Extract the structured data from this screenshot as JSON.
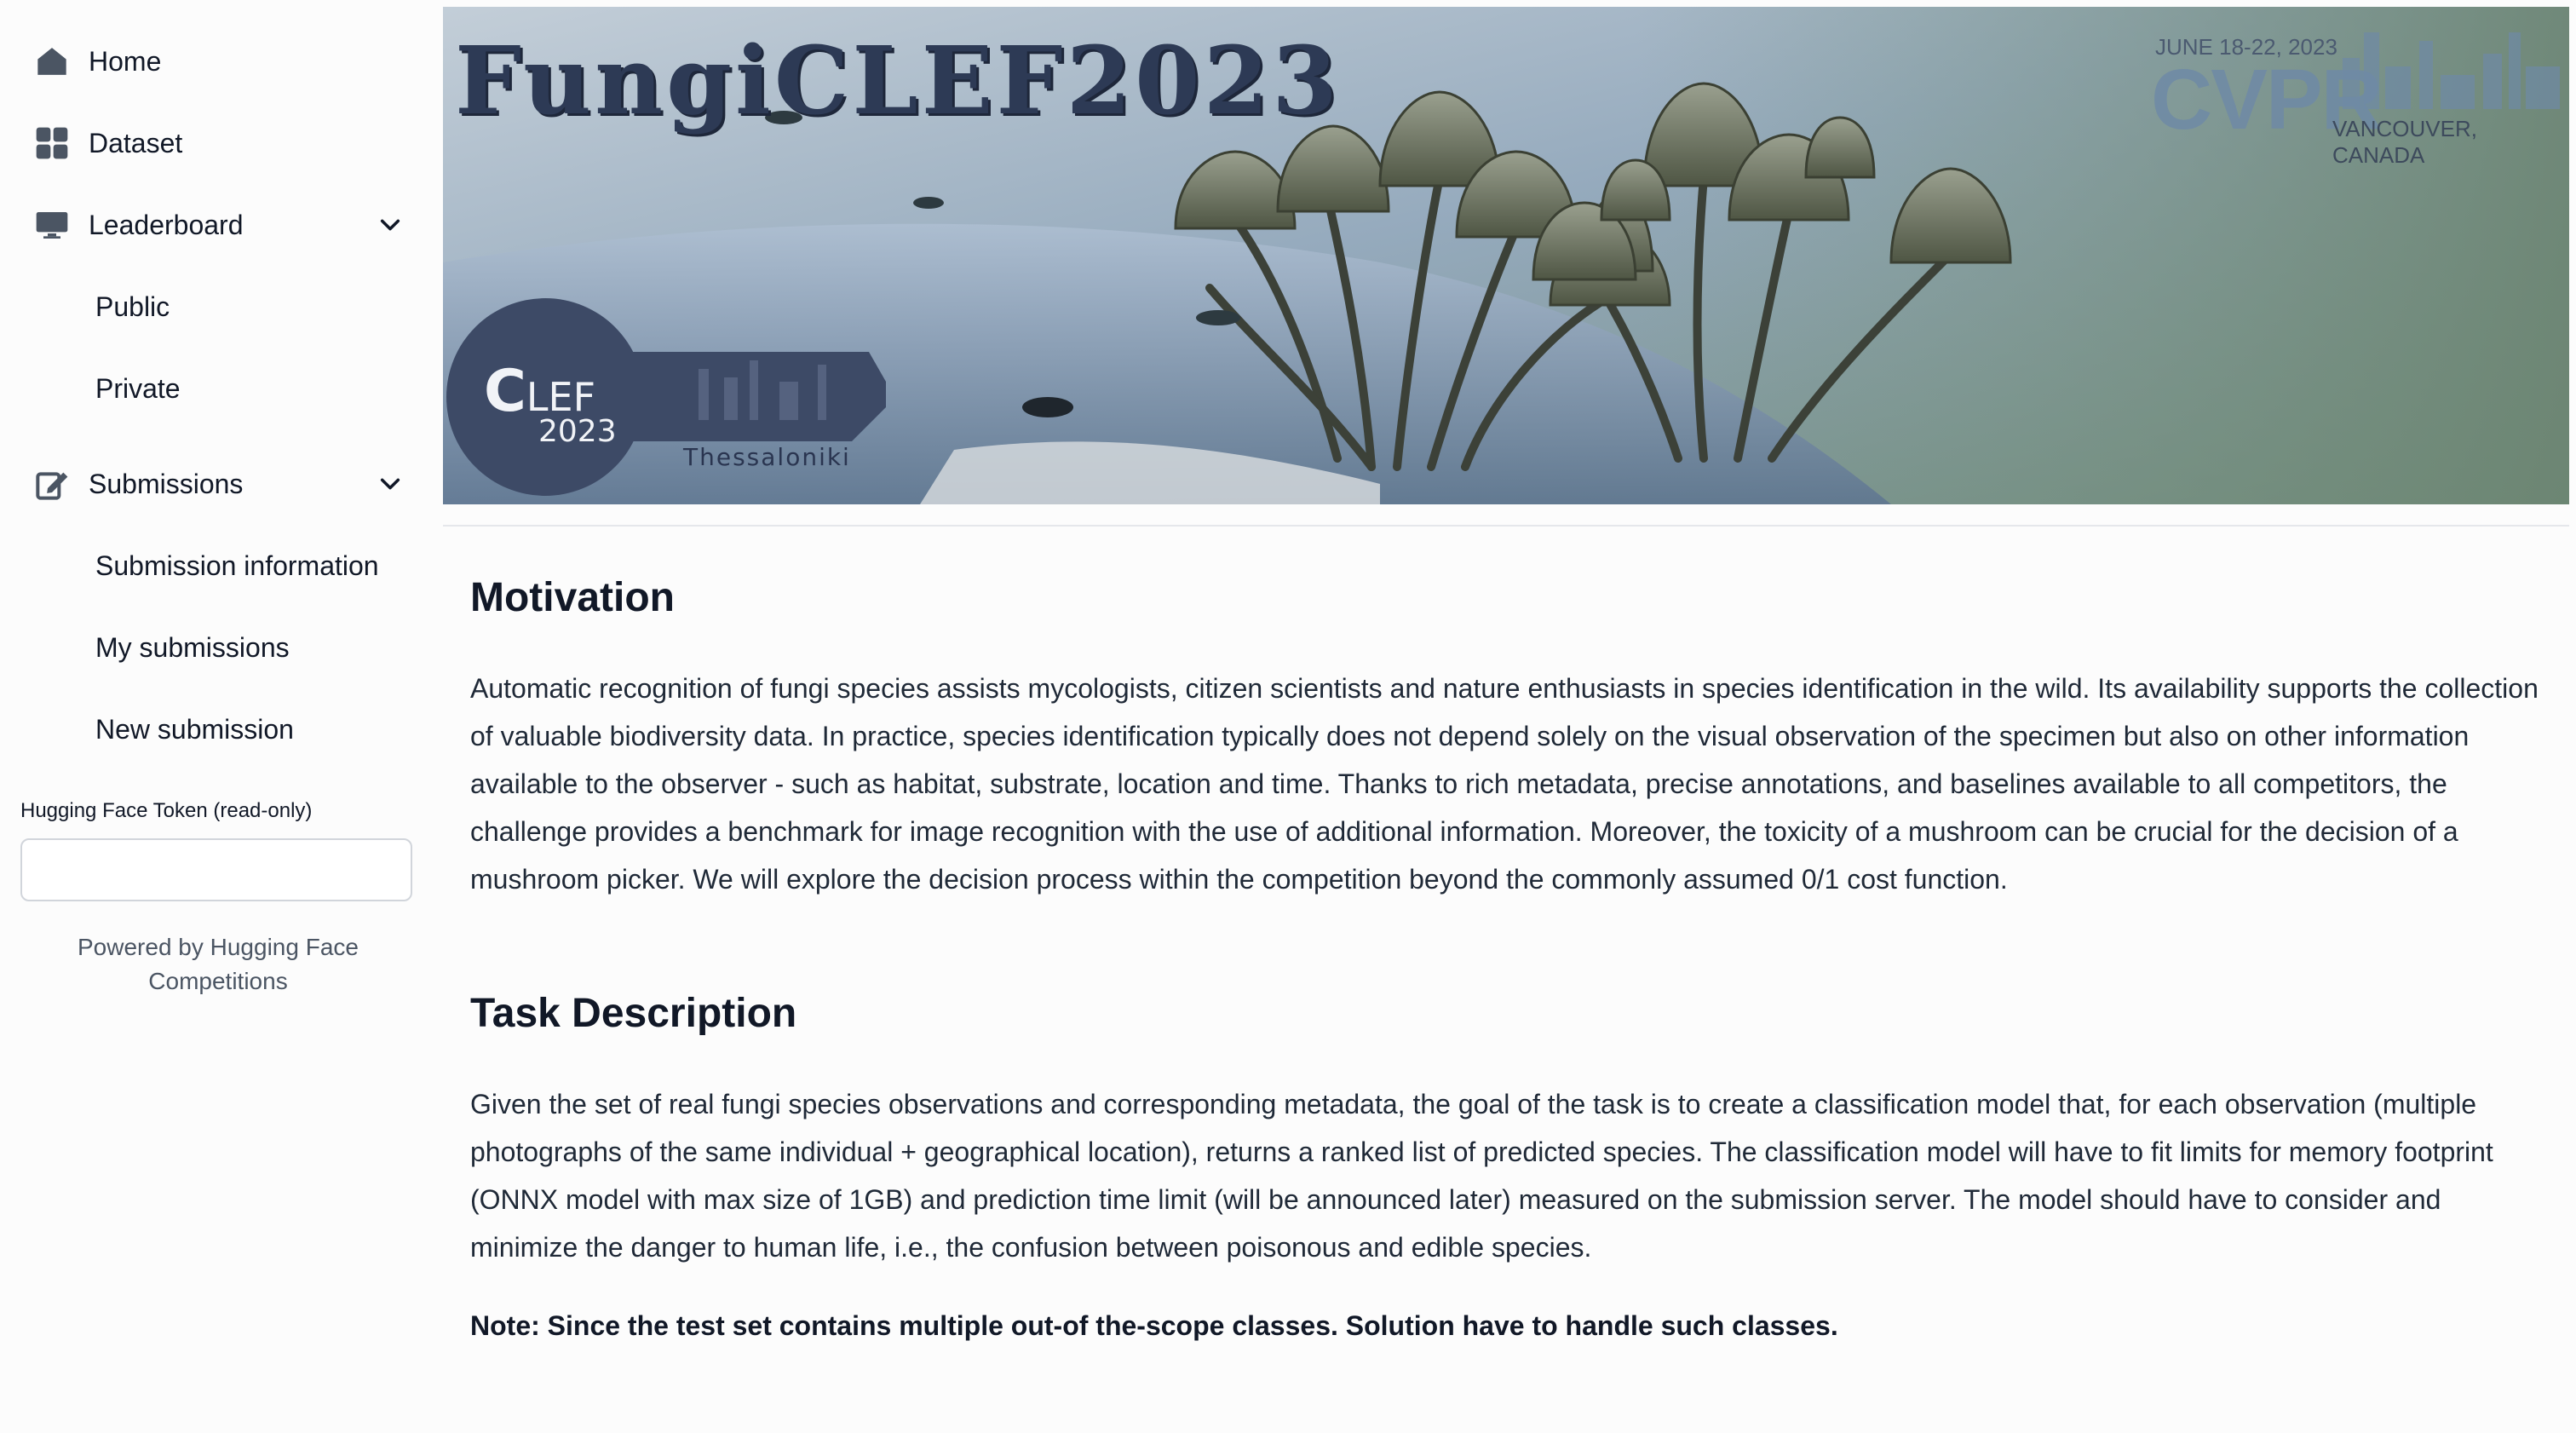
{
  "sidebar": {
    "items": [
      {
        "label": "Home",
        "icon": "home-icon"
      },
      {
        "label": "Dataset",
        "icon": "grid-icon"
      },
      {
        "label": "Leaderboard",
        "icon": "monitor-icon"
      },
      {
        "label": "Submissions",
        "icon": "edit-icon"
      }
    ],
    "leaderboard_sub": [
      "Public",
      "Private"
    ],
    "submissions_sub": [
      "Submission information",
      "My submissions",
      "New submission"
    ],
    "token_label": "Hugging Face Token (read-only)",
    "token_value": "",
    "powered_line1": "Powered by Hugging Face",
    "powered_line2": "Competitions"
  },
  "banner": {
    "title": "FungiCLEF2023",
    "cvpr_dates": "JUNE 18-22, 2023",
    "cvpr_name": "CVPR",
    "cvpr_location": "VANCOUVER, CANADA",
    "clef_c": "C",
    "clef_rest": "LEF",
    "clef_year": "2023",
    "clef_city": "Thessaloniki"
  },
  "main": {
    "motivation_heading": "Motivation",
    "motivation_text": "Automatic recognition of fungi species assists mycologists, citizen scientists and nature enthusiasts in species identification in the wild. Its availability supports the collection of valuable biodiversity data. In practice, species identification typically does not depend solely on the visual observation of the specimen but also on other information available to the observer - such as habitat, substrate, location and time. Thanks to rich metadata, precise annotations, and baselines available to all competitors, the challenge provides a benchmark for image recognition with the use of additional information. Moreover, the toxicity of a mushroom can be crucial for the decision of a mushroom picker. We will explore the decision process within the competition beyond the commonly assumed 0/1 cost function.",
    "task_heading": "Task Description",
    "task_text": "Given the set of real fungi species observations and corresponding metadata, the goal of the task is to create a classification model that, for each observation (multiple photographs of the same individual + geographical location), returns a ranked list of predicted species. The classification model will have to fit limits for memory footprint (ONNX model with max size of 1GB) and prediction time limit (will be announced later) measured on the submission server. The model should have to consider and minimize the danger to human life, i.e., the confusion between poisonous and edible species.",
    "note_text": "Note: Since the test set contains multiple out-of the-scope classes. Solution have to handle such classes."
  },
  "colors": {
    "text": "#111827",
    "muted": "#4b5563",
    "banner_title": "#2d3a55",
    "clef_badge": "#3d4a66"
  }
}
